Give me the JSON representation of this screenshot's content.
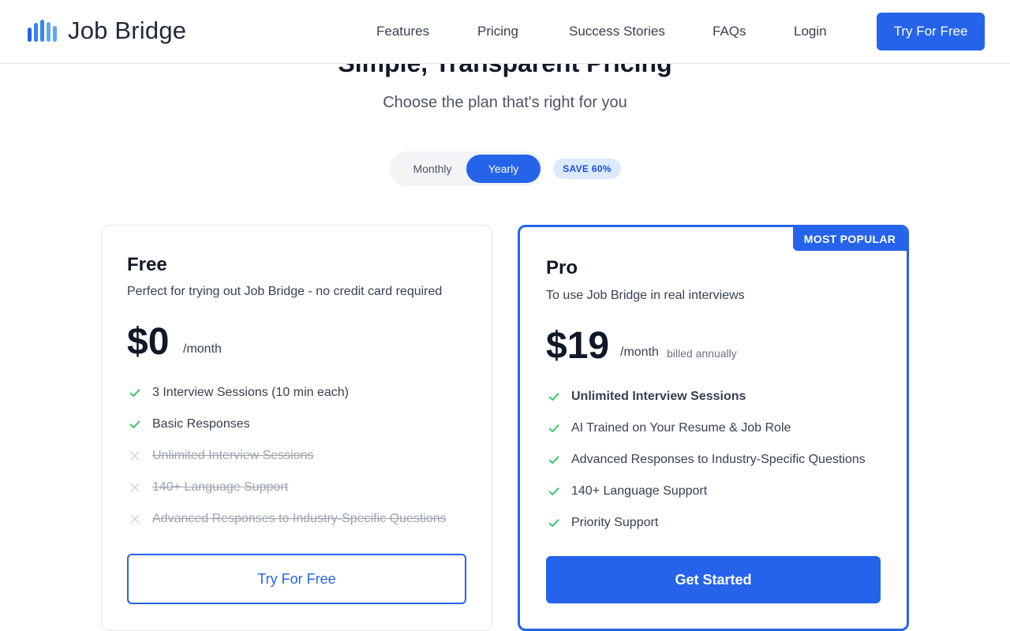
{
  "brand": {
    "name": "Job Bridge",
    "accent": "#2563eb"
  },
  "nav": {
    "items": [
      "Features",
      "Pricing",
      "Success Stories",
      "FAQs",
      "Login"
    ],
    "cta": "Try For Free"
  },
  "hero": {
    "title": "Simple, Transparent Pricing",
    "subtitle": "Choose the plan that's right for you"
  },
  "billing_toggle": {
    "options": [
      "Monthly",
      "Yearly"
    ],
    "selected": "Yearly",
    "badge": "SAVE 60%"
  },
  "plans": [
    {
      "name": "Free",
      "description": "Perfect for trying out Job Bridge - no credit card required",
      "price": "$0",
      "period": "/month",
      "features": [
        {
          "text": "3 Interview Sessions (10 min each)",
          "included": true
        },
        {
          "text": "Basic Responses",
          "included": true
        },
        {
          "text": "Unlimited Interview Sessions",
          "included": false
        },
        {
          "text": "140+ Language Support",
          "included": false
        },
        {
          "text": "Advanced Responses to Industry-Specific Questions",
          "included": false
        }
      ],
      "button": "Try For Free"
    },
    {
      "name": "Pro",
      "badge": "MOST POPULAR",
      "description": "To use Job Bridge in real interviews",
      "price": "$19",
      "period": "/month",
      "billing_note": "billed annually",
      "features": [
        {
          "text": "Unlimited Interview Sessions",
          "included": true,
          "emphasis": true
        },
        {
          "text": "AI Trained on Your Resume & Job Role",
          "included": true
        },
        {
          "text": "Advanced Responses to Industry-Specific Questions",
          "included": true
        },
        {
          "text": "140+ Language Support",
          "included": true
        },
        {
          "text": "Priority Support",
          "included": true
        }
      ],
      "button": "Get Started"
    }
  ],
  "icons": {
    "included": "check-icon",
    "excluded": "x-icon"
  },
  "colors": {
    "check": "#22c55e",
    "cross": "#d1d5db"
  }
}
